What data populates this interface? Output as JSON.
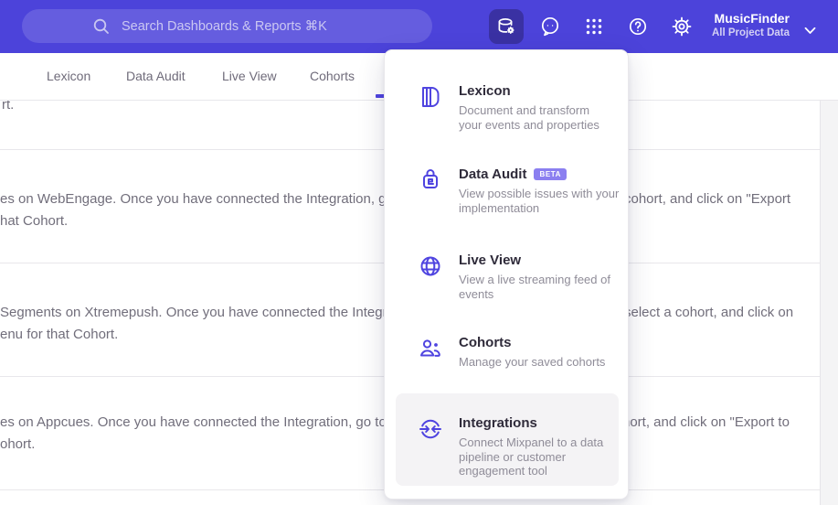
{
  "colors": {
    "header_bg": "#4c43da",
    "accent": "#4f44e0",
    "active_icon_bg": "#3a31a3",
    "badge_bg": "#8b7ff0",
    "highlight_bg": "#f4f3f5"
  },
  "header": {
    "search_placeholder": "Search Dashboards & Reports ⌘K",
    "icon_names": [
      "data-management-icon",
      "feedback-icon",
      "apps-grid-icon",
      "help-icon",
      "settings-icon"
    ],
    "project_name": "MusicFinder",
    "project_subtitle": "All Project Data"
  },
  "tabs": [
    {
      "label": "Lexicon"
    },
    {
      "label": "Data Audit"
    },
    {
      "label": "Live View"
    },
    {
      "label": "Cohorts"
    }
  ],
  "menu": {
    "items": [
      {
        "title": "Lexicon",
        "description": "Document and transform\nyour events and properties"
      },
      {
        "title": "Data Audit",
        "badge": "BETA",
        "description": "View possible issues with your\nimplementation"
      },
      {
        "title": "Live View",
        "description": "View a live streaming feed of\nevents"
      },
      {
        "title": "Cohorts",
        "description": "Manage your saved cohorts"
      },
      {
        "title": "Integrations",
        "description": "Connect Mixpanel to a data\npipeline or customer\nengagement tool",
        "highlighted": true
      }
    ]
  },
  "content": {
    "top_fragment": "rt.",
    "rows": [
      {
        "left_line1": "es on WebEngage. Once you have connected the Integration, go to the",
        "right_line1": "cohort, and click on \"Export",
        "left_line2": "hat Cohort."
      },
      {
        "left_line1": "Segments on Xtremepush. Once you have connected the Integration,",
        "right_line1": "select a cohort, and click on",
        "left_line2": "enu for that Cohort."
      },
      {
        "left_line1": "es on Appcues. Once you have connected the Integration, go to the M",
        "right_line1": "hort, and click on \"Export to",
        "left_line2": "ohort."
      }
    ]
  }
}
